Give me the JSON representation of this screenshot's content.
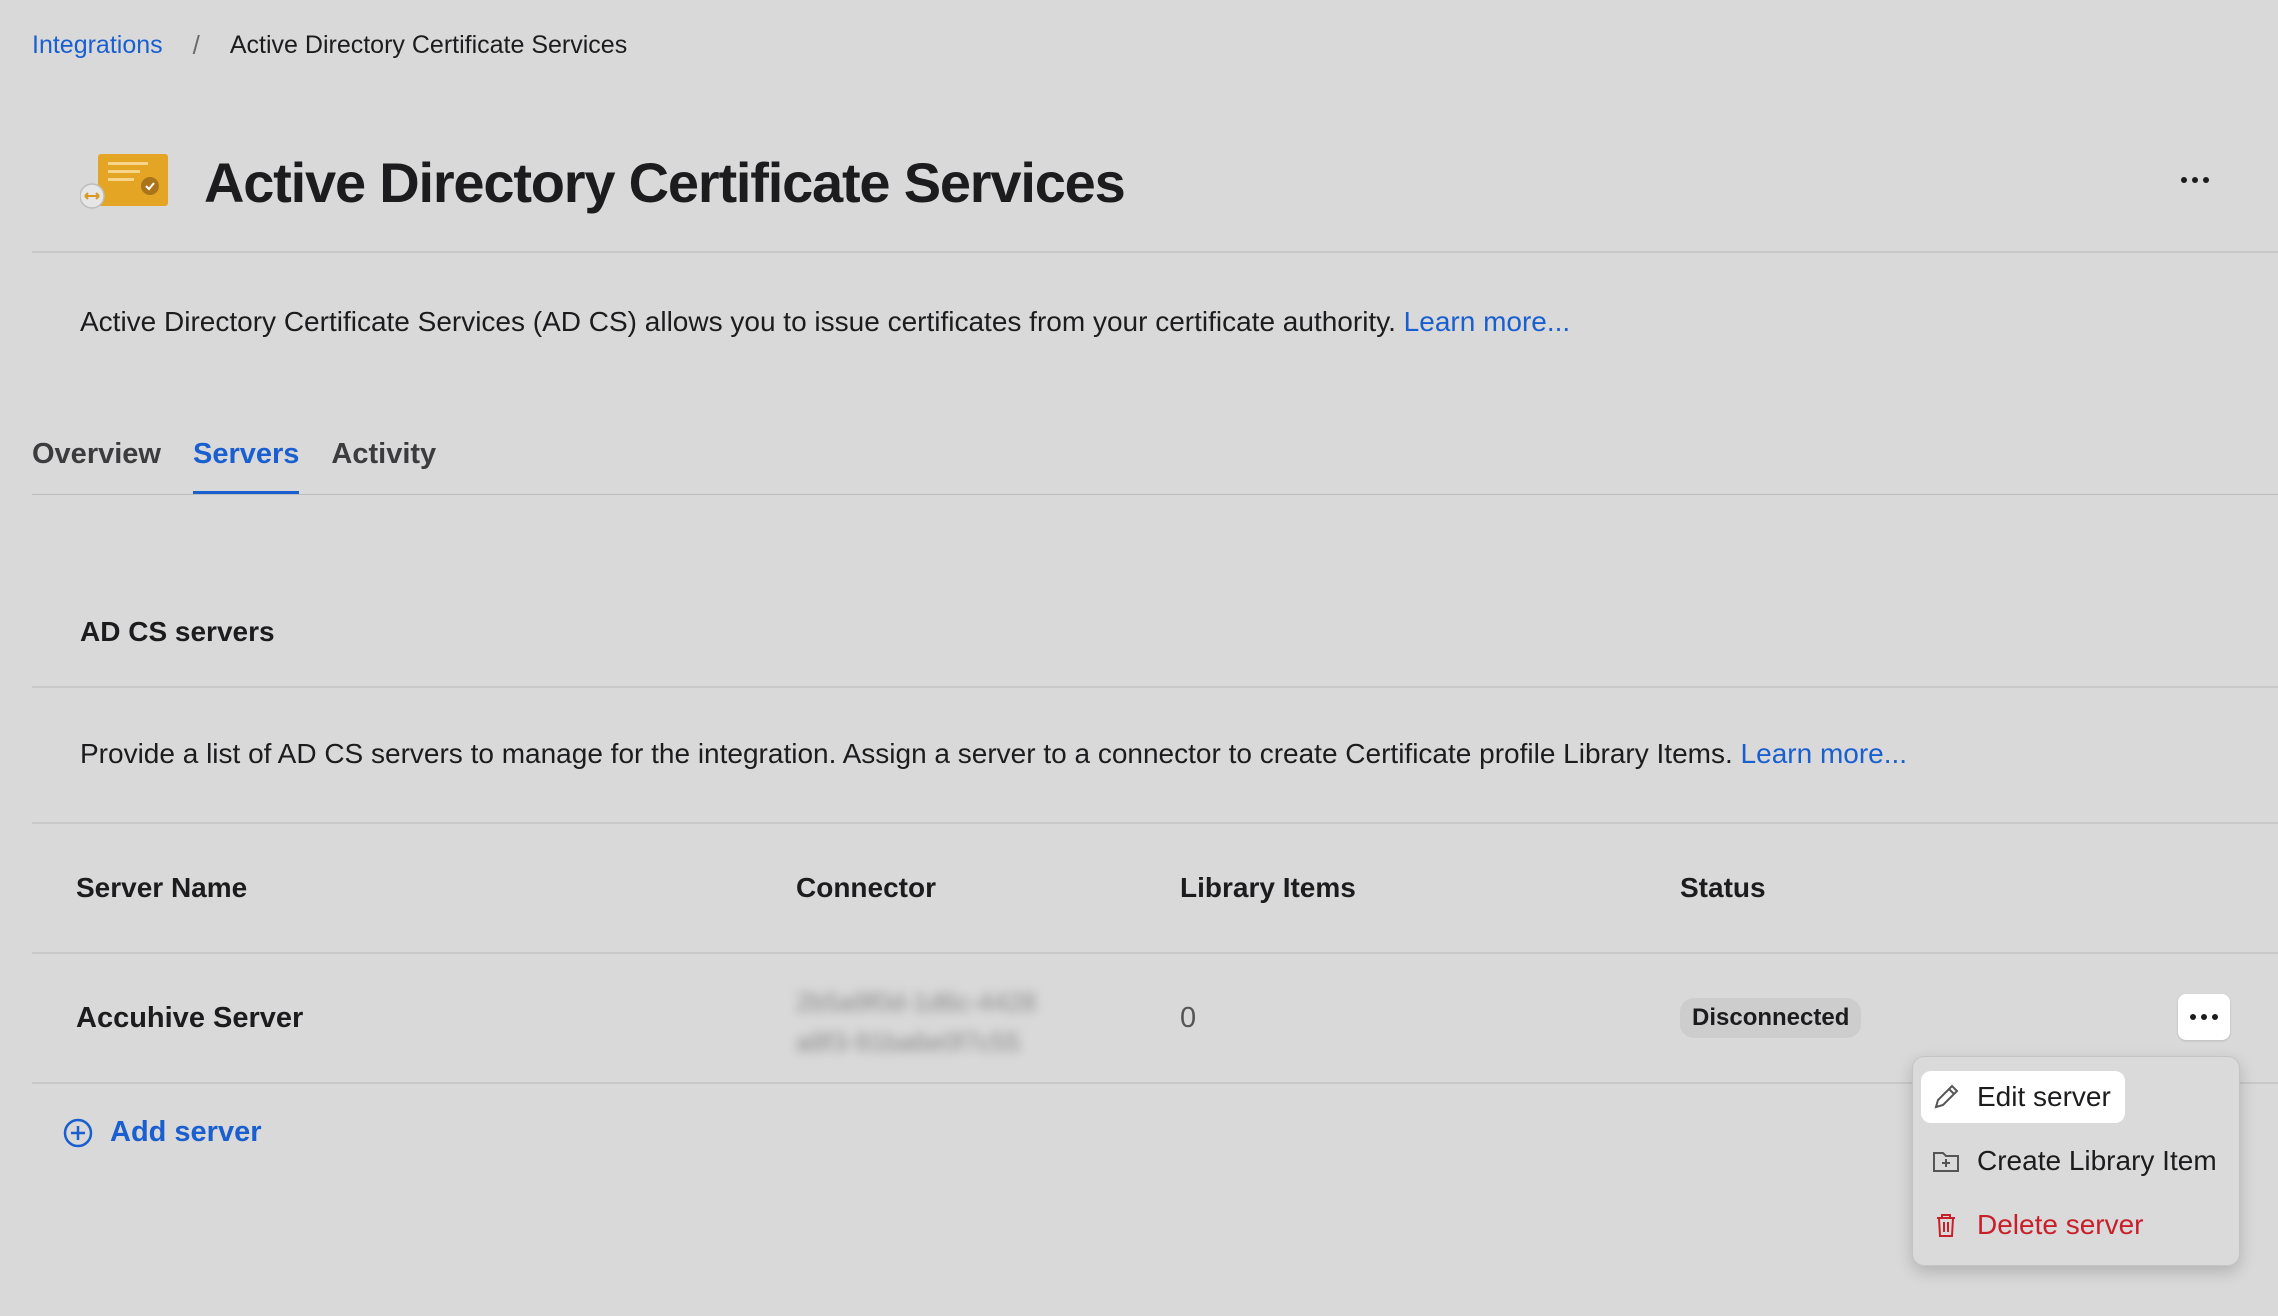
{
  "breadcrumb": {
    "parent": "Integrations",
    "separator": "/",
    "current": "Active Directory Certificate Services"
  },
  "header": {
    "title": "Active Directory Certificate Services",
    "icon": "certificate-integration-icon",
    "more_icon": "more-horizontal-icon"
  },
  "description": {
    "text": "Active Directory Certificate Services (AD CS) allows you to issue certificates from your certificate authority.",
    "link": "Learn more..."
  },
  "tabs": [
    {
      "label": "Overview",
      "active": false
    },
    {
      "label": "Servers",
      "active": true
    },
    {
      "label": "Activity",
      "active": false
    }
  ],
  "servers_section": {
    "title": "AD CS servers",
    "description": "Provide a list of AD CS servers to manage for the integration. Assign a server to a connector to create Certificate profile Library Items.",
    "link": "Learn more..."
  },
  "table": {
    "columns": [
      "Server Name",
      "Connector",
      "Library Items",
      "Status"
    ],
    "rows": [
      {
        "server_name": "Accuhive Server",
        "connector_line1": "2b5a9f0d-1d6c-4428",
        "connector_line2": "a8f3-91ba6e0f7c55",
        "library_items": "0",
        "status": "Disconnected"
      }
    ]
  },
  "add_server": {
    "label": "Add server",
    "icon": "plus-circle-icon"
  },
  "row_menu": {
    "items": [
      {
        "label": "Edit server",
        "icon": "pencil-icon"
      },
      {
        "label": "Create Library Item",
        "icon": "folder-plus-icon"
      },
      {
        "label": "Delete server",
        "icon": "trash-icon"
      }
    ]
  },
  "colors": {
    "background": "#d9d9d9",
    "link": "#1a5fd0",
    "danger": "#c8202a",
    "icon_accent": "#e3a523"
  }
}
